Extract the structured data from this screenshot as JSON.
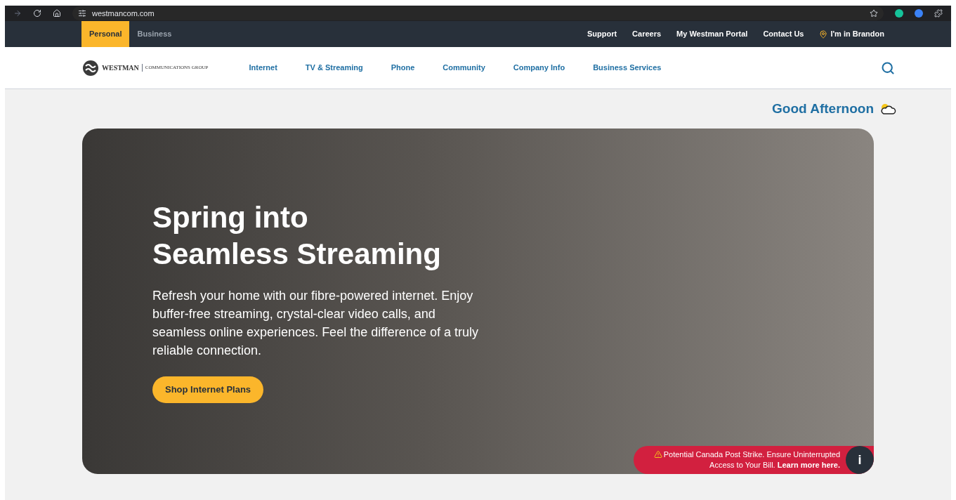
{
  "browser": {
    "url": "westmancom.com"
  },
  "top_bar": {
    "segments": [
      {
        "label": "Personal",
        "selected": true
      },
      {
        "label": "Business",
        "selected": false
      }
    ],
    "links": [
      "Support",
      "Careers",
      "My Westman Portal",
      "Contact Us"
    ],
    "location": "I'm in Brandon"
  },
  "nav": {
    "logo": {
      "name": "WESTMAN",
      "tagline": "COMMUNICATIONS GROUP"
    },
    "items": [
      "Internet",
      "TV & Streaming",
      "Phone",
      "Community",
      "Company Info",
      "Business Services"
    ]
  },
  "greeting": "Good Afternoon",
  "hero": {
    "title_lines": [
      "Spring into",
      "Seamless Streaming"
    ],
    "body": "Refresh your home with our fibre-powered internet. Enjoy buffer-free streaming, crystal-clear video calls, and seamless online experiences. Feel the difference of a truly reliable connection.",
    "button": "Shop Internet Plans"
  },
  "alert": {
    "text": "Potential Canada Post Strike. Ensure Uninterrupted Access to Your Bill.",
    "link": "Learn more here.",
    "info": "i"
  }
}
